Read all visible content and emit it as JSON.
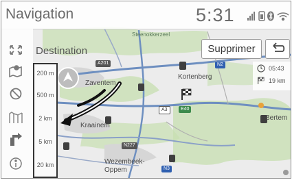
{
  "header": {
    "title": "Navigation",
    "clock": "5:31"
  },
  "destination": {
    "title": "Destination",
    "delete_label": "Supprimer"
  },
  "scale": {
    "items": [
      "200 m",
      "500 m",
      "2 km",
      "5 km",
      "20 km"
    ]
  },
  "eta": {
    "arrival": "05:43",
    "distance": "19 km"
  },
  "map": {
    "places": [
      "Zaventem",
      "Kortenberg",
      "Kraainem",
      "Bertem",
      "Wezembeek-Oppem",
      "Steenokkerzeel"
    ],
    "roads": [
      "A201",
      "N2",
      "A3",
      "E40",
      "N227",
      "N3"
    ]
  },
  "colors": {
    "map_bg": "#ececec",
    "land_green": "#c7dfb0",
    "road_blue": "#6e8fc0",
    "badge_blue": "#2f5fb0",
    "badge_green": "#3c8a4c"
  }
}
